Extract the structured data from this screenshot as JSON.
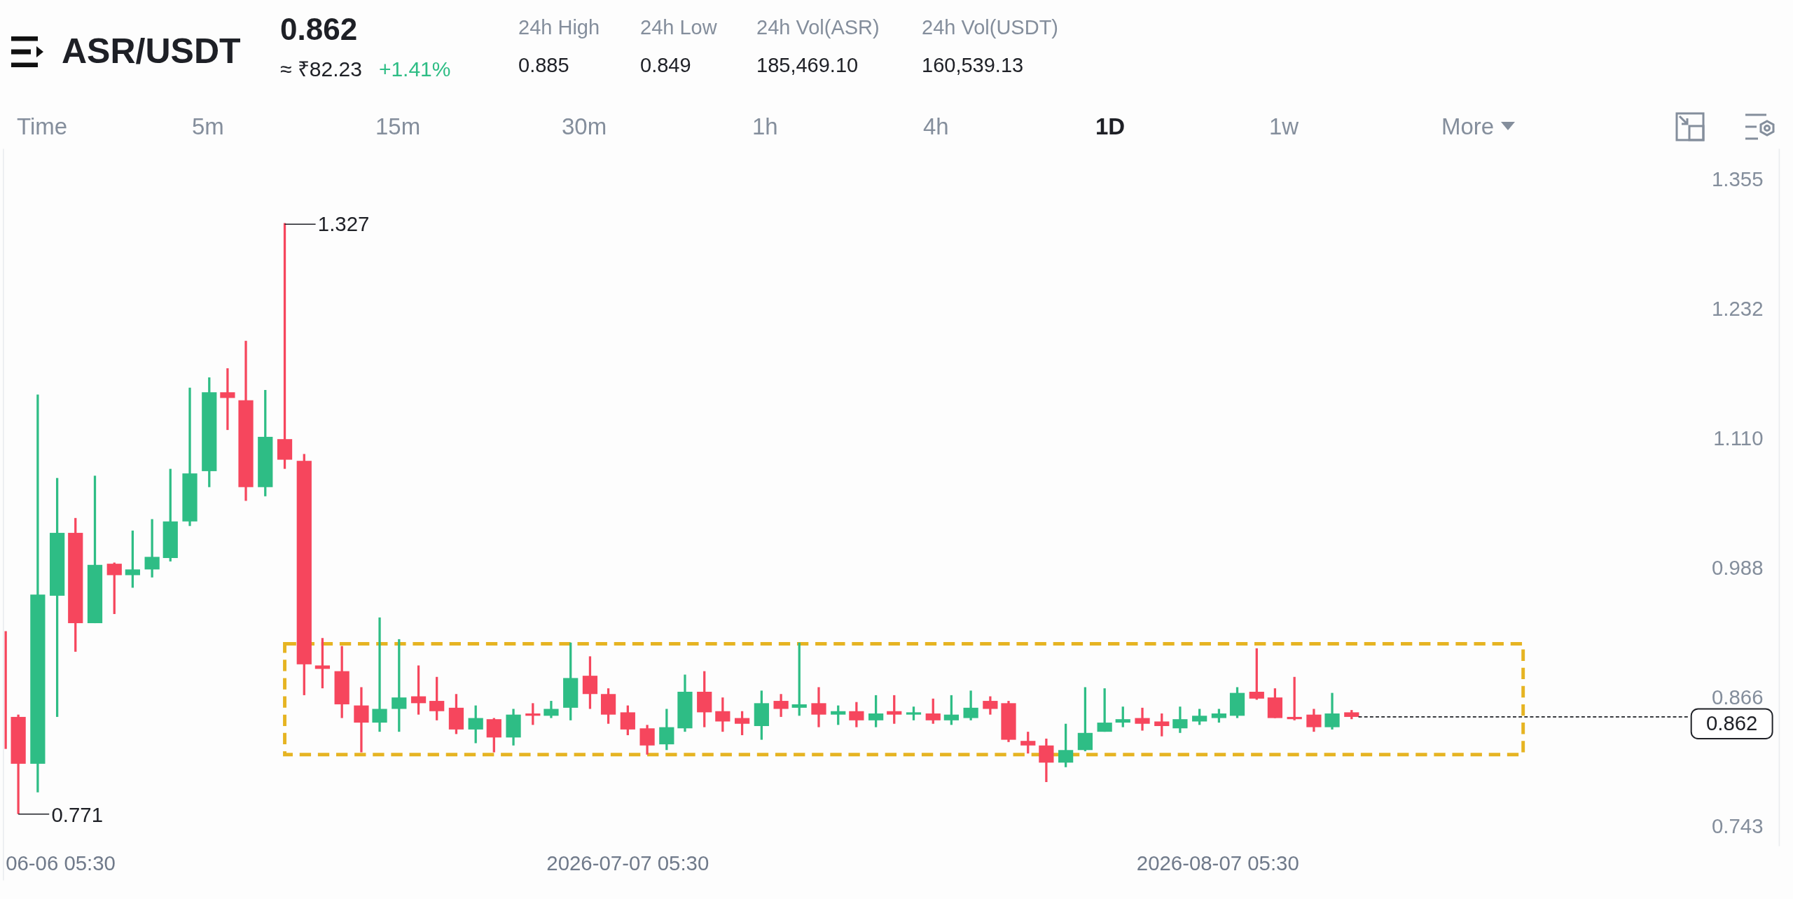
{
  "header": {
    "pair": "ASR/USDT",
    "price": "0.862",
    "fiat_price": "≈ ₹82.23",
    "change": "+1.41%",
    "stats": [
      {
        "label": "24h High",
        "value": "0.885"
      },
      {
        "label": "24h Low",
        "value": "0.849"
      },
      {
        "label": "24h Vol(ASR)",
        "value": "185,469.10"
      },
      {
        "label": "24h Vol(USDT)",
        "value": "160,539.13"
      }
    ]
  },
  "intervals": [
    {
      "label": "Time",
      "selected": false
    },
    {
      "label": "5m",
      "selected": false
    },
    {
      "label": "15m",
      "selected": false
    },
    {
      "label": "30m",
      "selected": false
    },
    {
      "label": "1h",
      "selected": false
    },
    {
      "label": "4h",
      "selected": false
    },
    {
      "label": "1D",
      "selected": true
    },
    {
      "label": "1w",
      "selected": false
    },
    {
      "label": "More",
      "selected": false
    }
  ],
  "chart": {
    "y_axis": [
      "1.355",
      "1.232",
      "1.110",
      "0.988",
      "0.866",
      "0.743"
    ],
    "x_axis": [
      "06-06 05:30",
      "2026-07-07 05:30",
      "2026-08-07 05:30"
    ],
    "high_marker": "1.327",
    "low_marker": "0.771",
    "last_price": "0.862"
  }
}
